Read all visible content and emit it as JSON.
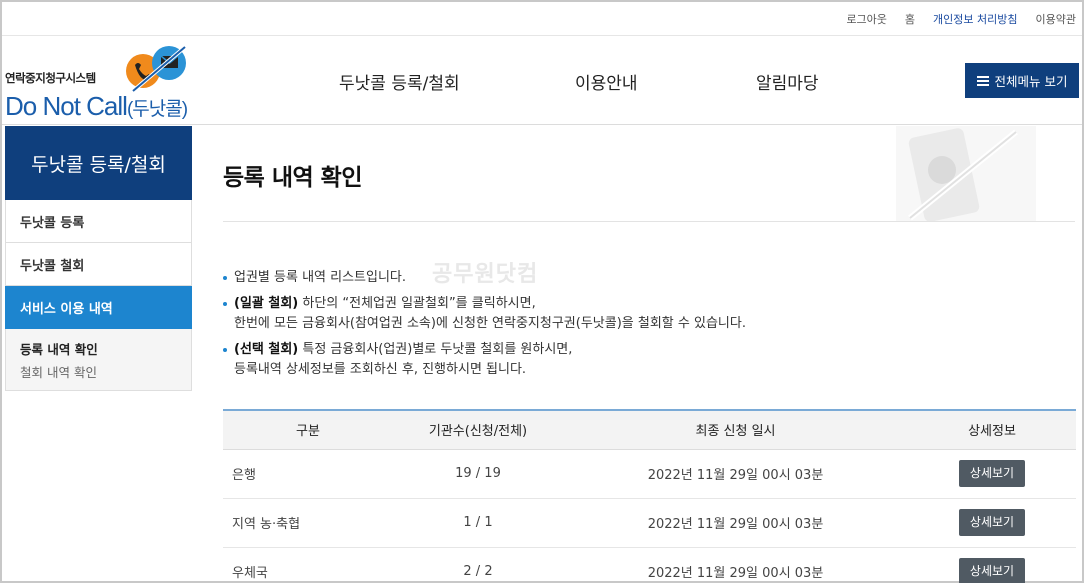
{
  "util_links": {
    "logout": "로그아웃",
    "home": "홈",
    "privacy": "개인정보 처리방침",
    "terms": "이용약관"
  },
  "logo": {
    "system_name": "연락중지청구시스템",
    "brand": "Do Not Call",
    "brand_kor": "(두낫콜)"
  },
  "gnb": [
    "두낫콜 등록/철회",
    "이용안내",
    "알림마당"
  ],
  "all_menu_label": "전체메뉴 보기",
  "sidebar": {
    "heading": "두낫콜 등록/철회",
    "items": [
      "두낫콜 등록",
      "두낫콜 철회",
      "서비스 이용 내역"
    ],
    "sub_items": [
      "등록 내역 확인",
      "철회 내역 확인"
    ]
  },
  "page_title": "등록 내역 확인",
  "notes": {
    "n1": "업권별 등록 내역 리스트입니다.",
    "n2_bold": "(일괄 철회)",
    "n2_text": " 하단의 “전체업권 일괄철회”를 클릭하시면,",
    "n2_line2": "한번에 모든 금융회사(참여업권 소속)에 신청한 연락중지청구권(두낫콜)을 철회할 수 있습니다.",
    "n3_bold": "(선택 철회)",
    "n3_text": " 특정 금융회사(업권)별로 두낫콜 철회를 원하시면,",
    "n3_line2": "등록내역 상세정보를 조회하신 후, 진행하시면 됩니다."
  },
  "watermark": "공무원닷컴",
  "table": {
    "headers": [
      "구분",
      "기관수(신청/전체)",
      "최종 신청 일시",
      "상세정보"
    ],
    "rows": [
      {
        "category": "은행",
        "count": "19 / 19",
        "date": "2022년 11월 29일 00시 03분",
        "button": "상세보기"
      },
      {
        "category": "지역 농·축협",
        "count": "1 / 1",
        "date": "2022년 11월 29일 00시 03분",
        "button": "상세보기"
      },
      {
        "category": "우체국",
        "count": "2 / 2",
        "date": "2022년 11월 29일 00시 03분",
        "button": "상세보기"
      }
    ]
  },
  "colors": {
    "primary": "#0f3f7d",
    "accent": "#1d85cf",
    "button": "#505a63"
  }
}
